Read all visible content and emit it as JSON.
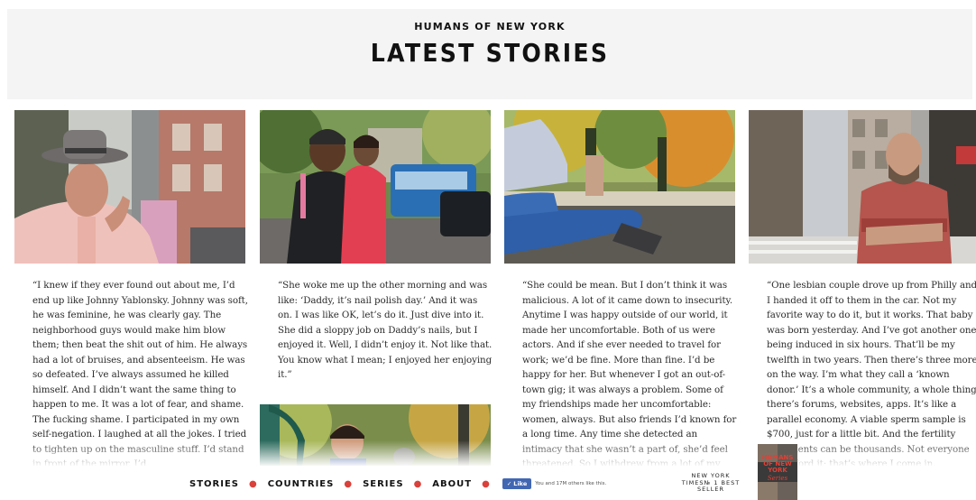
{
  "header": {
    "kicker": "HUMANS OF NEW YORK",
    "title": "LATEST STORIES"
  },
  "stories": [
    {
      "image_alt": "Older man in grey fedora and pink jacket on a city street",
      "text": "“I knew if they ever found out about me, I’d end up like Johnny Yablonsky. Johnny was soft, he was feminine, he was clearly gay. The neighborhood guys would make him blow them; then beat the shit out of him. He always had a lot of bruises, and absenteeism. He was so defeated. I’ve always assumed he killed himself. And I didn’t want the same thing to happen to me. It was a lot of fear, and shame. The fucking shame. I participated in my own self-negation. I laughed at all the jokes. I tried to tighten up on the masculine stuff. I’d stand in front of the mirror. I’d"
    },
    {
      "image_alt": "Smiling man holding a young girl near a blue bus",
      "text": "“She woke me up the other morning and was like: ‘Daddy, it’s nail polish day.’ And it was on. I was like OK, let’s do it. Just dive into it. She did a sloppy job on Daddy’s nails, but I enjoyed it. Well, I didn’t enjoy it. Not like that. You know what I mean; I enjoyed her enjoying it.”"
    },
    {
      "image_alt": "Person in jeans sitting on a bench in a park with autumn trees",
      "text": "“She could be mean. But I don’t think it was malicious. A lot of it came down to insecurity. Anytime I was happy outside of our world, it made her uncomfortable. Both of us were actors. And if she ever needed to travel for work; we’d be fine. More than fine. I’d be happy for her. But whenever I got an out-of-town gig; it was always a problem. Some of my friendships made her uncomfortable: women, always. But also friends I’d known for a long time. Any time she detected an intimacy that she wasn’t a part of, she’d feel threatened. So I withdrew from a lot of my"
    },
    {
      "image_alt": "Bald bearded man in plaid shirt with arms crossed on a street",
      "text": "“One lesbian couple drove up from Philly and I handed it off to them in the car. Not my favorite way to do it, but it works. That baby was born yesterday. And I’ve got another one being induced in six hours. That’ll be my twelfth in two years. Then there’s three more on the way. I’m what they call a ‘known donor.’ It’s a whole community, a whole thing: there’s forums, websites, apps. It’s like a parallel economy. A viable sperm sample is $700, just for a little bit. And the fertility treatments can be thousands. Not everyone can afford it; that’s where I come in."
    },
    {
      "image_alt": "Young boy at a playground"
    }
  ],
  "nav": {
    "items": [
      "STORIES",
      "COUNTRIES",
      "SERIES",
      "ABOUT"
    ],
    "like_button": "Like",
    "like_count": "You and 17M others like this.",
    "nyt_line1": "NEW YORK",
    "nyt_line2": "TIMES№ 1 BEST",
    "nyt_line3": "SELLER",
    "book_title": "HUMANS OF NEW YORK",
    "book_subtitle": "Series"
  },
  "colors": {
    "header_band": "#f4f4f4",
    "nav_dot": "#d9413a",
    "fb_blue": "#4267b2"
  }
}
